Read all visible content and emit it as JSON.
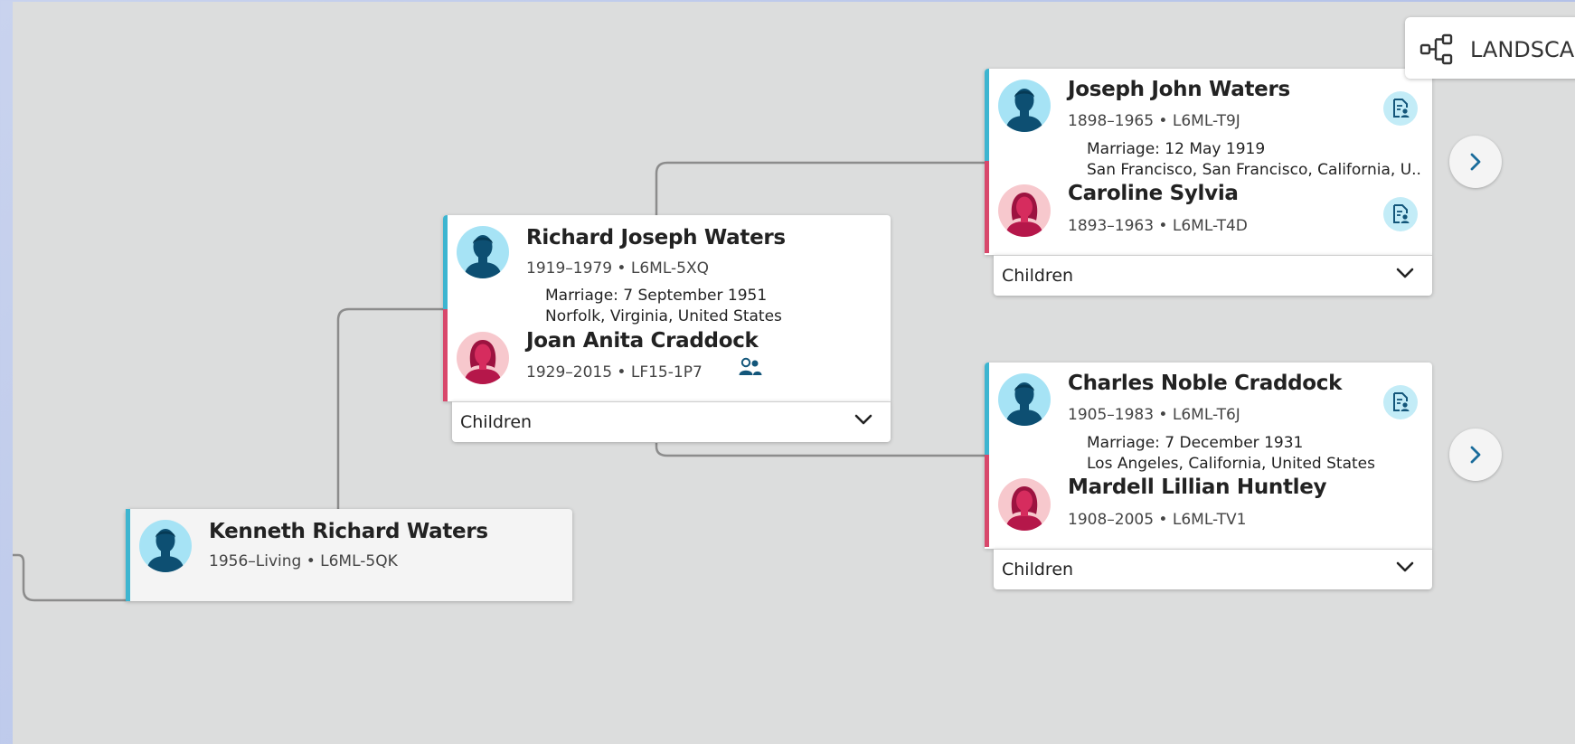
{
  "toolbar": {
    "view_label": "LANDSCAPE",
    "view_icon": "landscape-tree-icon"
  },
  "colors": {
    "male": "#3db5d0",
    "female": "#d8486b",
    "canvas": "#dcdddd",
    "icon_accent": "#13567a"
  },
  "focus_person": {
    "name": "Kenneth Richard Waters",
    "meta": "1956–Living • L6ML-5QK"
  },
  "parents": {
    "husband": {
      "name": "Richard Joseph Waters",
      "meta": "1919–1979 • L6ML-5XQ"
    },
    "marriage": "Marriage: 7 September 1951",
    "place": "Norfolk, Virginia, United States",
    "wife": {
      "name": "Joan Anita Craddock",
      "meta": "1929–2015 • LF15-1P7"
    },
    "children_label": "Children"
  },
  "paternal_grandparents": {
    "husband": {
      "name": "Joseph John Waters",
      "meta": "1898–1965 • L6ML-T9J"
    },
    "marriage": "Marriage: 12 May 1919",
    "place": "San Francisco, San Francisco, California, U...",
    "wife": {
      "name": "Caroline Sylvia",
      "meta": "1893–1963 • L6ML-T4D"
    },
    "children_label": "Children"
  },
  "maternal_grandparents": {
    "husband": {
      "name": "Charles Noble Craddock",
      "meta": "1905–1983 • L6ML-T6J"
    },
    "marriage": "Marriage: 7 December 1931",
    "place": "Los Angeles, California, United States",
    "wife": {
      "name": "Mardell Lillian Huntley",
      "meta": "1908–2005 • L6ML-TV1"
    },
    "children_label": "Children"
  }
}
